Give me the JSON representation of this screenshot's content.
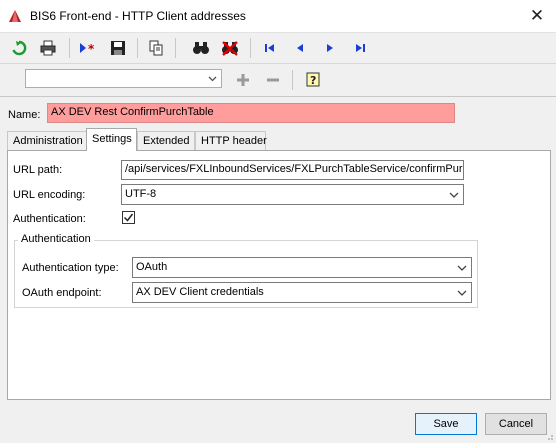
{
  "window": {
    "title": "BIS6 Front-end - HTTP Client addresses",
    "close_glyph": "✕"
  },
  "toolbar": {
    "buttons": [
      "refresh-icon",
      "print-icon",
      "new-record-icon",
      "save-icon",
      "copy-icon",
      "find-icon",
      "clear-find-icon",
      "first-record-icon",
      "previous-record-icon",
      "next-record-icon",
      "last-record-icon"
    ],
    "secondary": [
      "add-icon",
      "remove-icon",
      "help-icon"
    ]
  },
  "form": {
    "name_label": "Name:",
    "name_value": "AX DEV Rest ConfirmPurchTable"
  },
  "tabs": [
    {
      "label": "Administration"
    },
    {
      "label": "Settings"
    },
    {
      "label": "Extended"
    },
    {
      "label": "HTTP header"
    }
  ],
  "settings": {
    "url_path_label": "URL path:",
    "url_path_value": "/api/services/FXLInboundServices/FXLPurchTableService/confirmPurch",
    "url_encoding_label": "URL encoding:",
    "url_encoding_value": "UTF-8",
    "authentication_label": "Authentication:",
    "authentication_checked": true,
    "group_title": "Authentication",
    "auth_type_label": "Authentication type:",
    "auth_type_value": "OAuth",
    "oauth_endpoint_label": "OAuth endpoint:",
    "oauth_endpoint_value": "AX DEV Client credentials"
  },
  "buttons": {
    "save": "Save",
    "cancel": "Cancel"
  },
  "colors": {
    "name_field_bg": "#ff9d9d",
    "accent": "#0078d7",
    "nav_blue": "#1a3fd6"
  }
}
